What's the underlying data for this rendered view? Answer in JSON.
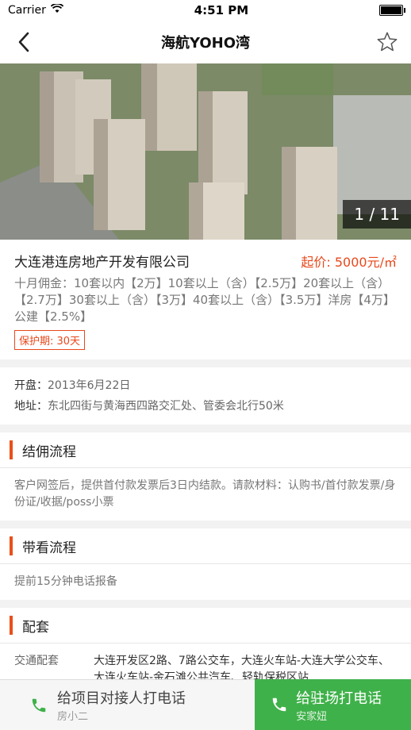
{
  "statusbar": {
    "carrier": "Carrier",
    "time": "4:51 PM",
    "battery_level": 1.0
  },
  "navbar": {
    "title": "海航YOHO湾"
  },
  "gallery": {
    "counter": "1 / 11"
  },
  "project": {
    "company": "大连港连房地产开发有限公司",
    "price_prefix": "起价:",
    "price_value": "5000元/㎡",
    "commission": "十月佣金：10套以内【2万】10套以上（含）【2.5万】20套以上（含）【2.7万】30套以上（含）【3万】40套以上（含）【3.5万】洋房【4万】公建【2.5%】",
    "protection": "保护期: 30天"
  },
  "info": {
    "open_label": "开盘：",
    "open_value": "2013年6月22日",
    "address_label": "地址：",
    "address_value": "东北四街与黄海西四路交汇处、管委会北行50米"
  },
  "sections": {
    "settlement": {
      "title": "结佣流程",
      "body": "客户网签后，提供首付款发票后3日内结款。请款材料：认购书/首付款发票/身份证/收据/poss小票"
    },
    "visit": {
      "title": "带看流程",
      "body": "提前15分钟电话报备"
    },
    "amenities": {
      "title": "配套",
      "traffic_label": "交通配套",
      "traffic_value": "大连开发区2路、7路公交车，大连火车站-大连大学公交车、大连火车站-金石滩公共汽车、轻轨保税区站"
    }
  },
  "footer": {
    "call_contact_label": "给项目对接人打电话",
    "call_contact_sub": "房小二",
    "call_onsite_label": "给驻场打电话",
    "call_onsite_sub": "安家妞"
  },
  "colors": {
    "accent": "#e8481c",
    "call_green": "#3fb14a"
  },
  "icons": [
    "back-icon",
    "star-icon",
    "phone-icon",
    "wifi-icon"
  ]
}
